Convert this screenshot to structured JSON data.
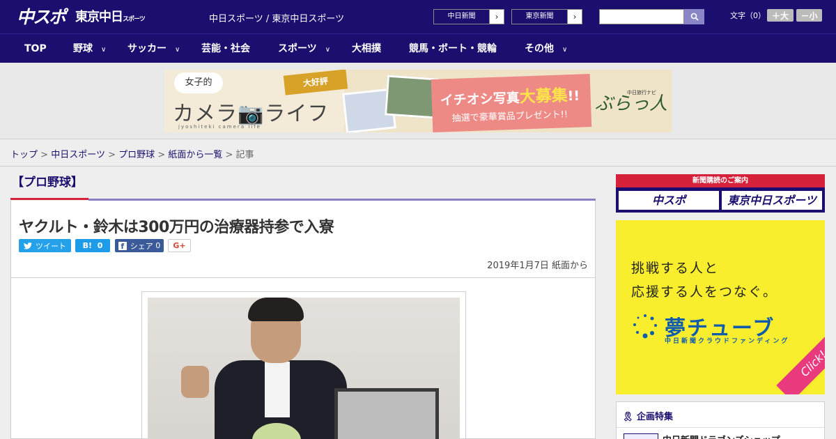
{
  "header": {
    "logo_main": "中スポ",
    "logo_tokyo": "東京中日",
    "logo_tokyo_small": "スポーツ",
    "site_title": "中日スポーツ / 東京中日スポーツ",
    "ext_links": [
      {
        "label": "中日新聞",
        "arrow": "›"
      },
      {
        "label": "東京新聞",
        "arrow": "›"
      }
    ],
    "search": {
      "placeholder": "",
      "value": ""
    },
    "text_size_label": "文字（0）",
    "size_up_label": "＋大",
    "size_down_label": "－小"
  },
  "nav": {
    "items": [
      {
        "label": "TOP",
        "has_menu": false
      },
      {
        "label": "野球",
        "has_menu": true
      },
      {
        "label": "サッカー",
        "has_menu": true
      },
      {
        "label": "芸能・社会",
        "has_menu": false
      },
      {
        "label": "スポーツ",
        "has_menu": true
      },
      {
        "label": "大相撲",
        "has_menu": false
      },
      {
        "label": "競馬・ボート・競輪",
        "has_menu": false
      },
      {
        "label": "その他",
        "has_menu": true
      }
    ]
  },
  "banner": {
    "bubble": "女子的",
    "title": "カメラ📷ライフ",
    "subtitle": "jyoshiteki camera life",
    "badge": "大好評",
    "headline_pre": "イチオシ写真",
    "headline_big": "大募集",
    "headline_post": "!!",
    "tagline": "抽選で豪華賞品プレゼント!!",
    "brand": "ぶらっ人",
    "brand_small": "中日旅行ナビ"
  },
  "breadcrumb": {
    "items": [
      "トップ",
      "中日スポーツ",
      "プロ野球",
      "紙面から一覧"
    ],
    "current": "記事",
    "separator": ">"
  },
  "article": {
    "category": "【プロ野球】",
    "title": "ヤクルト・鈴木は300万円の治療器持参で入寮",
    "share": {
      "tweet": "ツイート",
      "hatena": "B!",
      "hatena_count": "0",
      "facebook": "シェア",
      "facebook_count": "0",
      "gplus": "G+"
    },
    "date": "2019年1月7日 紙面から"
  },
  "sidebar": {
    "subscribe_header": "新聞購読のご案内",
    "subscribe_buttons": [
      "中スポ",
      "東京中日スポーツ"
    ],
    "ad_line1": "挑戦する人と",
    "ad_line2": "応援する人をつなぐ。",
    "ad_brand": "夢チューブ",
    "ad_brand_sub": "中日新聞クラウドファンディング",
    "ad_click": "Click!",
    "feature_title": "企画特集",
    "feature_item": "中日新聞ドラゴンズショップ"
  },
  "colors": {
    "brand_navy": "#1a0f6e",
    "accent_red": "#d6213a",
    "twitter": "#24a1e8",
    "facebook": "#3b5a99"
  }
}
